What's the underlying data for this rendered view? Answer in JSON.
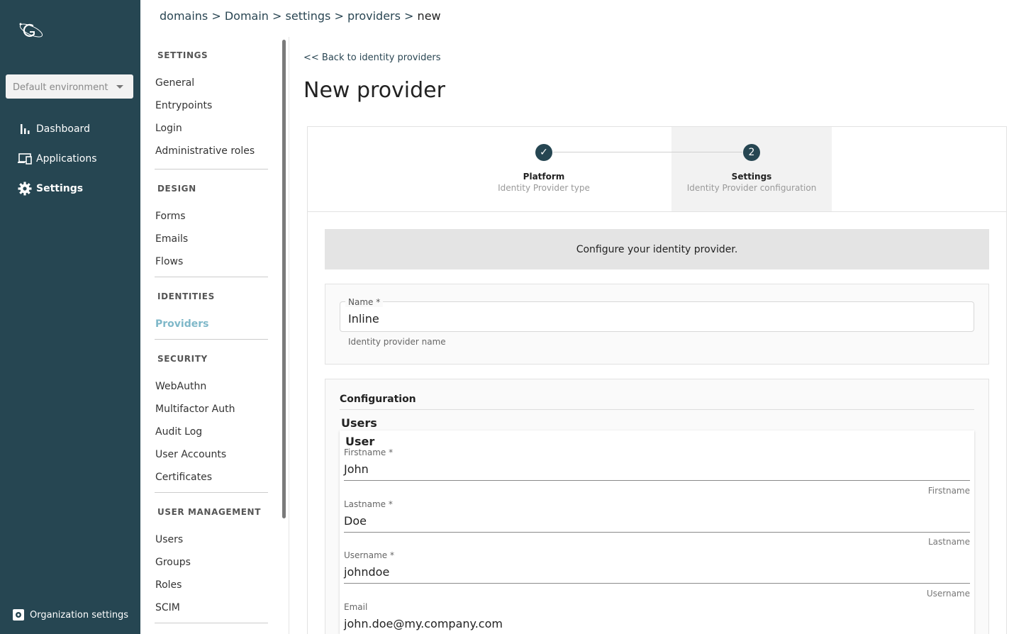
{
  "nav": {
    "env_select": "Default environment",
    "items": [
      {
        "label": "Dashboard",
        "icon": "bar-chart-icon"
      },
      {
        "label": "Applications",
        "icon": "devices-icon"
      },
      {
        "label": "Settings",
        "icon": "gear-icon"
      }
    ],
    "org_settings": "Organization settings"
  },
  "breadcrumb": {
    "items": [
      "domains",
      "Domain",
      "settings",
      "providers"
    ],
    "separator": ">",
    "current": "new"
  },
  "sidebar": {
    "sections": [
      {
        "title": "SETTINGS",
        "links": [
          "General",
          "Entrypoints",
          "Login",
          "Administrative roles"
        ]
      },
      {
        "title": "DESIGN",
        "links": [
          "Forms",
          "Emails",
          "Flows"
        ]
      },
      {
        "title": "IDENTITIES",
        "links": [
          "Providers"
        ]
      },
      {
        "title": "SECURITY",
        "links": [
          "WebAuthn",
          "Multifactor Auth",
          "Audit Log",
          "User Accounts",
          "Certificates"
        ]
      },
      {
        "title": "USER MANAGEMENT",
        "links": [
          "Users",
          "Groups",
          "Roles",
          "SCIM"
        ]
      }
    ],
    "active": "Providers"
  },
  "main": {
    "back_link": "<< Back to identity providers",
    "title": "New provider",
    "stepper": {
      "steps": [
        {
          "label": "Platform",
          "sub": "Identity Provider type",
          "marker": "✓"
        },
        {
          "label": "Settings",
          "sub": "Identity Provider configuration",
          "marker": "2"
        }
      ]
    },
    "banner": "Configure your identity provider.",
    "name_field": {
      "label": "Name *",
      "value": "Inline",
      "hint": "Identity provider name"
    },
    "configuration": {
      "title": "Configuration",
      "users_title": "Users",
      "user_title": "User",
      "fields": [
        {
          "label": "Firstname *",
          "value": "John",
          "hint": "Firstname"
        },
        {
          "label": "Lastname *",
          "value": "Doe",
          "hint": "Lastname"
        },
        {
          "label": "Username *",
          "value": "johndoe",
          "hint": "Username"
        },
        {
          "label": "Email",
          "value": "john.doe@my.company.com",
          "hint": ""
        }
      ]
    }
  },
  "colors": {
    "nav_bg": "#264652",
    "active_link": "#7fb8c9",
    "step_circle": "#264652"
  }
}
